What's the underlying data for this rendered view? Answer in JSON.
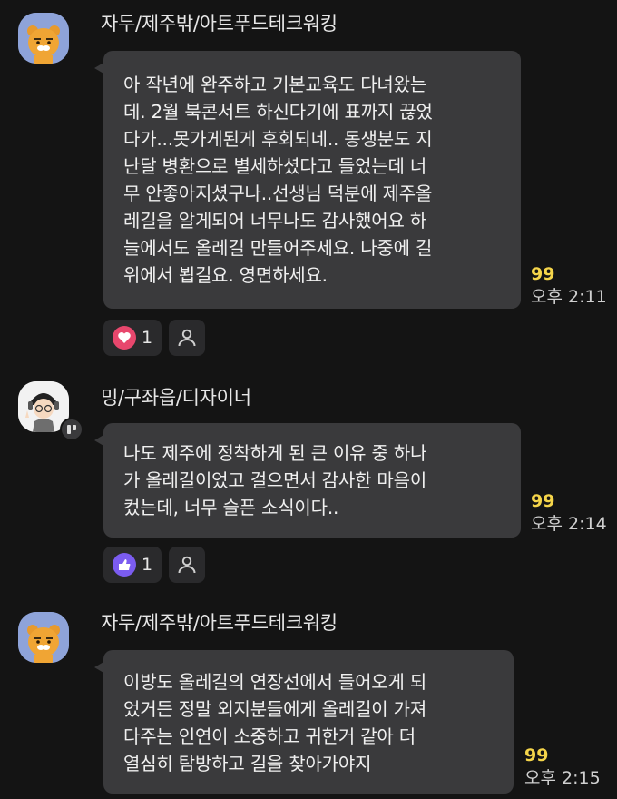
{
  "messages": [
    {
      "sender": "자두/제주밖/아트푸드테크워킹",
      "lines": [
        "아 작년에 완주하고 기본교육도 다녀왔는",
        "데. 2월 북콘서트 하신다기에 표까지 끊었",
        "다가...못가게된게 후회되네.. 동생분도 지",
        "난달 병환으로 별세하셨다고 들었는데 너",
        "무 안좋아지셨구나..선생님 덕분에 제주올",
        "레길을 알게되어 너무나도 감사했어요 하",
        "늘에서도 올레길 만들어주세요. 나중에 길",
        "위에서 뵙길요. 영면하세요."
      ],
      "unread": "99",
      "time": "오후 2:11",
      "reaction": {
        "icon": "heart-icon",
        "count": "1",
        "color": "#e8476d"
      }
    },
    {
      "sender": "밍/구좌읍/디자이너",
      "lines": [
        "나도 제주에 정착하게 된 큰 이유 중 하나",
        "가 올레길이었고 걸으면서 감사한 마음이",
        "컸는데, 너무 슬픈 소식이다.."
      ],
      "unread": "99",
      "time": "오후 2:14",
      "reaction": {
        "icon": "thumbs-up-icon",
        "count": "1",
        "color": "#7b5cf0"
      }
    },
    {
      "sender": "자두/제주밖/아트푸드테크워킹",
      "lines": [
        "이방도 올레길의 연장선에서 들어오게 되",
        "었거든 정말 외지분들에게 올레길이 가져",
        "다주는 인연이 소중하고 귀한거 같아 더",
        "열심히 탐방하고 길을 찾아가야지"
      ],
      "unread": "99",
      "time": "오후 2:15"
    }
  ],
  "colors": {
    "background": "#141414",
    "bubble": "#3a3a3c",
    "unread": "#f5d54a"
  }
}
